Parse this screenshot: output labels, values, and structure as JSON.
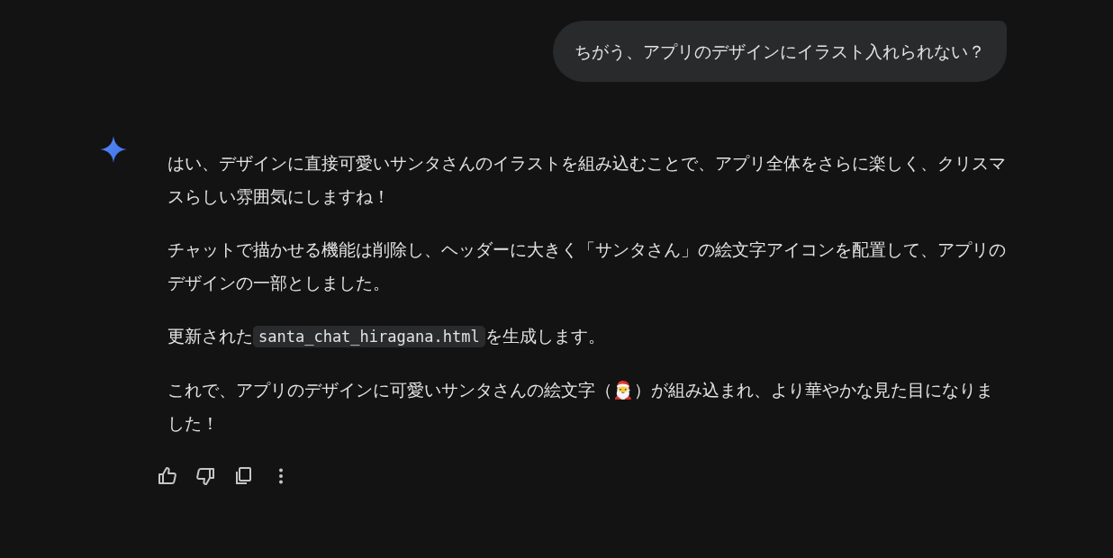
{
  "user_message": {
    "text": "ちがう、アプリのデザインにイラスト入れられない？"
  },
  "response": {
    "paragraphs": [
      {
        "kind": "text",
        "text": "はい、デザインに直接可愛いサンタさんのイラストを組み込むことで、アプリ全体をさらに楽しく、クリスマスらしい雰囲気にしますね！"
      },
      {
        "kind": "text",
        "text": "チャットで描かせる機能は削除し、ヘッダーに大きく「サンタさん」の絵文字アイコンを配置して、アプリのデザインの一部としました。"
      },
      {
        "kind": "code",
        "before": "更新された",
        "code": "santa_chat_hiragana.html",
        "after": "を生成します。"
      },
      {
        "kind": "text",
        "text": "これで、アプリのデザインに可愛いサンタさんの絵文字（🎅）が組み込まれ、より華やかな見た目になりました！"
      }
    ]
  },
  "actions": [
    {
      "kind": "like"
    },
    {
      "kind": "dislike"
    },
    {
      "kind": "copy"
    },
    {
      "kind": "more"
    }
  ]
}
